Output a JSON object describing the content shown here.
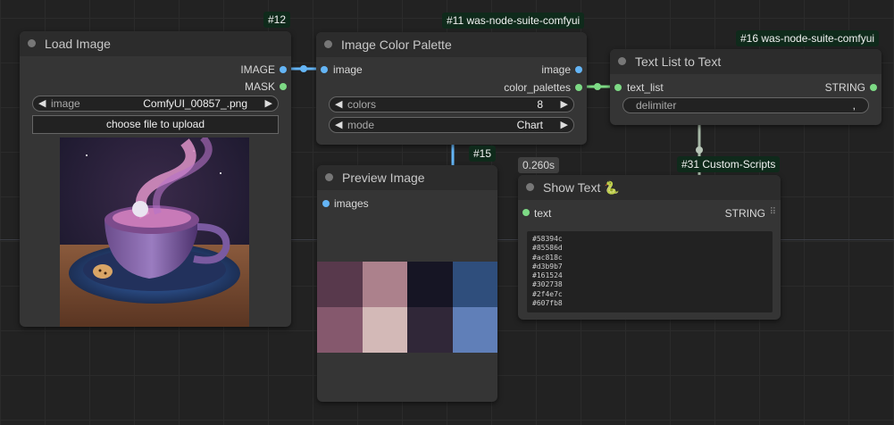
{
  "nodes": {
    "load_image": {
      "badge": "#12",
      "title": "Load Image",
      "outputs": [
        "IMAGE",
        "MASK"
      ],
      "widget_name": "image",
      "widget_value": "ComfyUI_00857_.png",
      "upload_label": "choose file to upload",
      "preview_alt": "cup of coffee with swirling pink cosmic smoke"
    },
    "palette": {
      "badge": "#11 was-node-suite-comfyui",
      "title": "Image Color Palette",
      "input": "image",
      "outputs": [
        "image",
        "color_palettes"
      ],
      "colors_name": "colors",
      "colors_value": "8",
      "mode_name": "mode",
      "mode_value": "Chart"
    },
    "text_list": {
      "badge": "#16 was-node-suite-comfyui",
      "title": "Text List to Text",
      "input": "text_list",
      "output": "STRING",
      "delimiter_name": "delimiter",
      "delimiter_value": ","
    },
    "preview": {
      "badge": "#15",
      "title": "Preview Image",
      "input": "images"
    },
    "show_text": {
      "badge": "#31 Custom-Scripts",
      "timing": "0.260s",
      "title": "Show Text",
      "title_icon": "🐍",
      "input": "text",
      "output": "STRING",
      "lines": [
        "#58394c",
        "#85586d",
        "#ac818c",
        "#d3b9b7",
        "#161524",
        "#302738",
        "#2f4e7c",
        "#607fb8"
      ]
    }
  },
  "swatches": [
    "#58394c",
    "#ac818c",
    "#161524",
    "#2f4e7c",
    "#85586d",
    "#d3b9b7",
    "#302738",
    "#607fb8"
  ],
  "colors": {
    "image_link": "#64b5f6",
    "string_link": "#7dda85",
    "badge_bg": "#0f2a1b"
  }
}
